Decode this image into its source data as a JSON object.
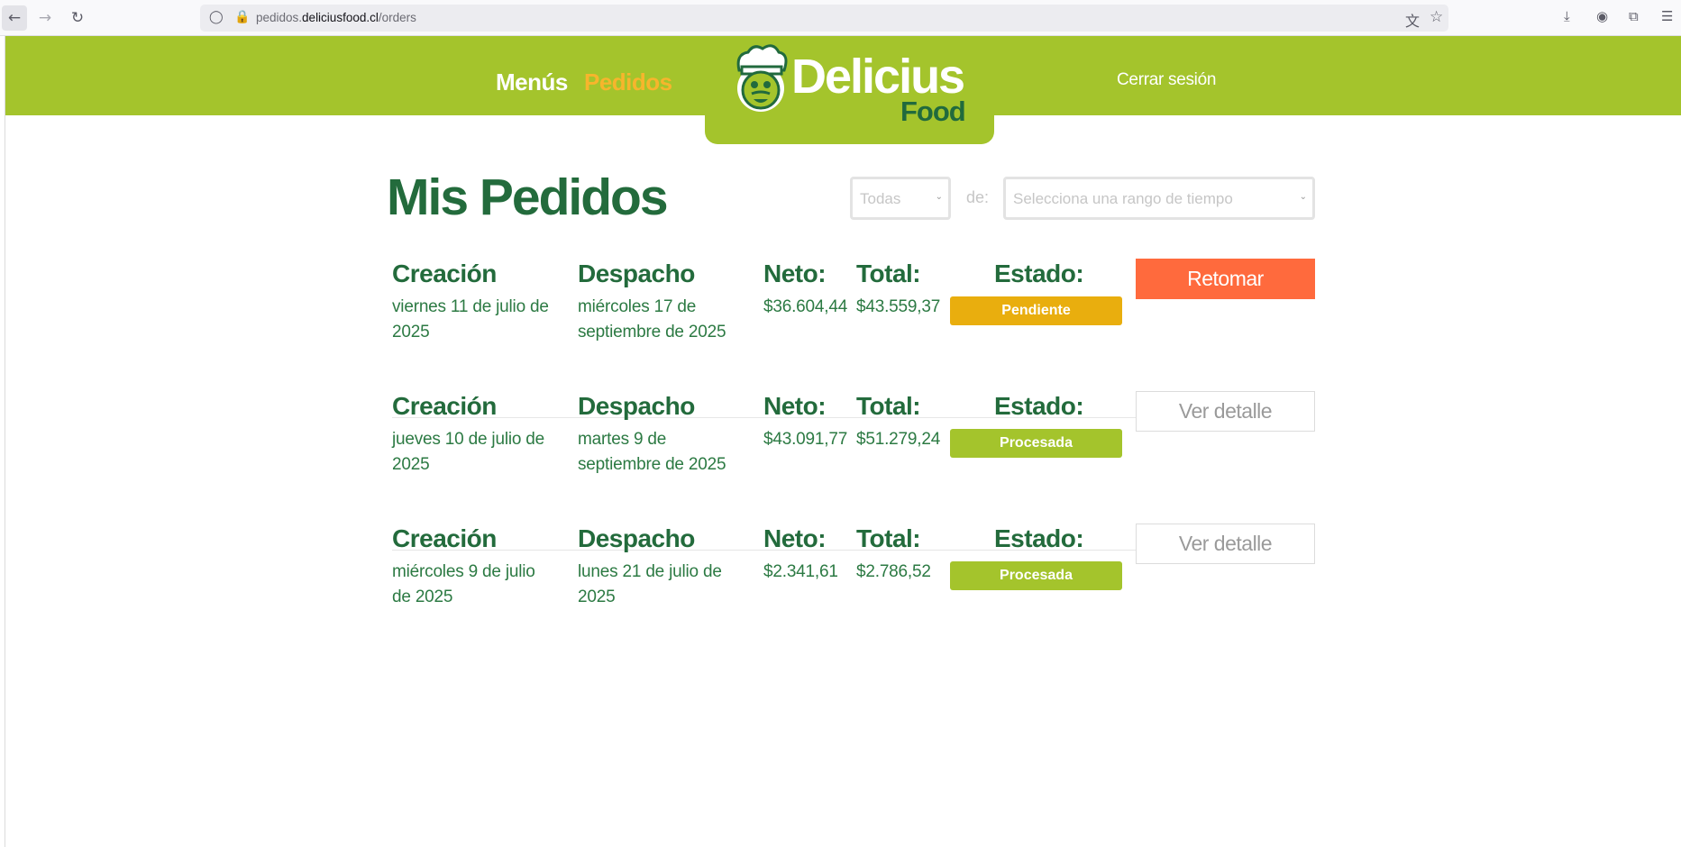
{
  "browser": {
    "url_prefix": "pedidos.",
    "url_domain": "deliciusfood.cl",
    "url_path": "/orders"
  },
  "header": {
    "nav_menus": "Menús",
    "nav_pedidos": "Pedidos",
    "brand_top": "Delicius",
    "brand_bottom": "Food",
    "logout": "Cerrar sesión",
    "colors": {
      "bar": "#a4c42c",
      "active_nav": "#f7b52c",
      "brand_dark": "#216a3d"
    }
  },
  "main": {
    "title": "Mis Pedidos",
    "filter_status": "Todas",
    "filter_of": "de:",
    "filter_range_placeholder": "Selecciona una rango de tiempo"
  },
  "labels": {
    "created": "Creación",
    "dispatch": "Despacho",
    "net": "Neto:",
    "total": "Total:",
    "status": "Estado:"
  },
  "orders": [
    {
      "created_l1": "viernes 11 de julio de",
      "created_l2": "2025",
      "dispatch_l1": "miércoles 17 de",
      "dispatch_l2": "septiembre de 2025",
      "net": "$36.604,44",
      "total": "$43.559,37",
      "status": "Pendiente",
      "status_color": "#e9ae0e",
      "action": "Retomar"
    },
    {
      "created_l1": "jueves 10 de julio de",
      "created_l2": "2025",
      "dispatch_l1": "martes 9 de",
      "dispatch_l2": "septiembre de 2025",
      "net": "$43.091,77",
      "total": "$51.279,24",
      "status": "Procesada",
      "status_color": "#a4c42c",
      "action": "Ver detalle"
    },
    {
      "created_l1": "miércoles 9 de julio",
      "created_l2": "de 2025",
      "dispatch_l1": "lunes 21 de julio de",
      "dispatch_l2": "2025",
      "net": "$2.341,61",
      "total": "$2.786,52",
      "status": "Procesada",
      "status_color": "#a4c42c",
      "action": "Ver detalle"
    }
  ]
}
